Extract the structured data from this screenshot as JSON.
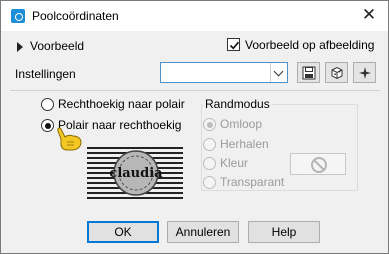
{
  "window": {
    "title": "Poolcoördinaten",
    "close_glyph": "✕"
  },
  "preview": {
    "expander_label": "Voorbeeld",
    "checkbox_label": "Voorbeeld op afbeelding",
    "checkbox_checked": true
  },
  "settings": {
    "label": "Instellingen",
    "preset_value": "",
    "tools": [
      "save-preset-icon",
      "reset-icon",
      "randomize-icon"
    ]
  },
  "mode": {
    "options": [
      {
        "label": "Rechthoekig naar polair",
        "checked": false
      },
      {
        "label": "Polair naar rechthoekig",
        "checked": true
      }
    ]
  },
  "edge_mode": {
    "group_label": "Randmodus",
    "options": [
      {
        "label": "Omloop",
        "checked": true,
        "disabled": true
      },
      {
        "label": "Herhalen",
        "checked": false,
        "disabled": true
      },
      {
        "label": "Kleur",
        "checked": false,
        "disabled": true
      },
      {
        "label": "Transparant",
        "checked": false,
        "disabled": true
      }
    ]
  },
  "preview_image": {
    "text": "claudia"
  },
  "buttons": {
    "ok": "OK",
    "cancel": "Annuleren",
    "help": "Help"
  },
  "colors": {
    "accent": "#0078d7",
    "title_icon": "#1d8fd8",
    "pointer": "#f3c824"
  }
}
